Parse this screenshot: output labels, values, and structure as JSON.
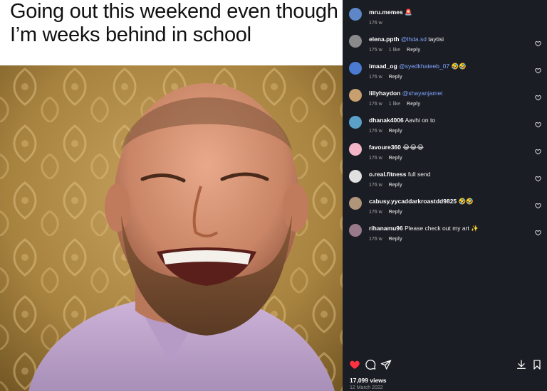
{
  "post": {
    "caption_line1": "Going out this weekend even though",
    "caption_line2": "I’m weeks behind in school"
  },
  "author": {
    "username": "mru.memes",
    "badge_emoji": "🚨",
    "age": "176 w"
  },
  "comments": [
    {
      "username": "elena.ppth",
      "mention": "@lhda.sd",
      "text": " taytisi",
      "age": "175 w",
      "likes": "1 like",
      "reply_label": "Reply",
      "avatar_color": "#8a8a8a"
    },
    {
      "username": "imaad_og",
      "mention": "@syedkhateeb_07",
      "text": " 🤣🤣",
      "age": "176 w",
      "likes": "",
      "reply_label": "Reply",
      "avatar_color": "#4a7bd1"
    },
    {
      "username": "lillyhaydon",
      "mention": "@shayanjamei",
      "text": "",
      "age": "176 w",
      "likes": "1 like",
      "reply_label": "Reply",
      "avatar_color": "#c8a070"
    },
    {
      "username": "dhanak4006",
      "mention": "",
      "text": " Aavhi on to",
      "age": "176 w",
      "likes": "",
      "reply_label": "Reply",
      "avatar_color": "#5aa0c8"
    },
    {
      "username": "favoure360",
      "mention": "",
      "text": " 😂😂😂",
      "age": "176 w",
      "likes": "",
      "reply_label": "Reply",
      "avatar_color": "#f2b6c8"
    },
    {
      "username": "o.real.fitness",
      "mention": "",
      "text": " full send",
      "age": "176 w",
      "likes": "",
      "reply_label": "Reply",
      "avatar_color": "#e0e0e0"
    },
    {
      "username": "cabusy.yycaddarkroastdd9825",
      "mention": "",
      "text": " 🤣🤣",
      "age": "176 w",
      "likes": "",
      "reply_label": "Reply",
      "avatar_color": "#b0957a"
    },
    {
      "username": "rihanamu96",
      "mention": "",
      "text": " Please check out my art ✨",
      "age": "176 w",
      "likes": "",
      "reply_label": "Reply",
      "avatar_color": "#9a7a8a"
    }
  ],
  "actions": {
    "like_icon": "heart-filled-icon",
    "comment_icon": "comment-icon",
    "share_icon": "send-icon",
    "download_icon": "download-icon",
    "save_icon": "bookmark-icon",
    "like_color": "#ff3040"
  },
  "stats": {
    "views": "17,099 views",
    "date": "12 March 2022"
  },
  "colors": {
    "panel_bg": "#1a1d23",
    "mention": "#7fa3ff"
  }
}
